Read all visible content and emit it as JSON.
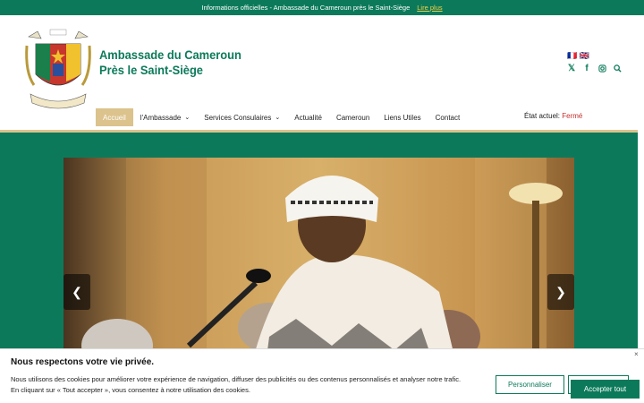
{
  "topbar": {
    "text": "Informations officielles - Ambassade du Cameroun près le Saint-Siège",
    "link": "Lire plus"
  },
  "header": {
    "title_line1": "Ambassade du Cameroun",
    "title_line2": "Près le Saint-Siège",
    "lang1": "🇫🇷 🇬🇧",
    "lang2": "",
    "social": [
      "x-icon",
      "facebook-icon",
      "instagram-icon",
      "search-icon"
    ]
  },
  "nav": {
    "items": [
      {
        "label": "Accueil",
        "active": true
      },
      {
        "label": "l'Ambassade",
        "dropdown": true
      },
      {
        "label": "Services Consulaires",
        "dropdown": true
      },
      {
        "label": "Actualité"
      },
      {
        "label": "Cameroun"
      },
      {
        "label": "Liens Utiles"
      },
      {
        "label": "Contact"
      }
    ],
    "status_label": "État actuel:",
    "status_value": "Fermé"
  },
  "slider": {
    "prev": "❮",
    "next": "❯"
  },
  "cookie": {
    "title": "Nous respectons votre vie privée.",
    "text1": "Nous utilisons des cookies pour améliorer votre expérience de navigation, diffuser des publicités ou des contenus personnalisés et analyser notre trafic.",
    "text2": "En cliquant sur « Tout accepter », vous consentez à notre utilisation des cookies.",
    "personalize": "Personnaliser",
    "accept": "Accepter tout",
    "close": "×"
  },
  "colors": {
    "brand": "#0c7a5a",
    "accent": "#dcc28c",
    "closed": "#c62d2d"
  }
}
